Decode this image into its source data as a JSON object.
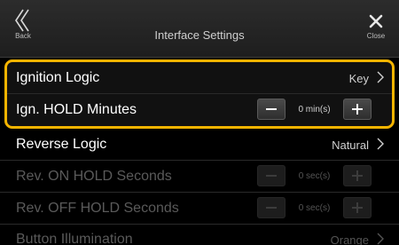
{
  "header": {
    "title": "Interface Settings",
    "back_label": "Back",
    "close_label": "Close"
  },
  "rows": [
    {
      "label": "Ignition Logic",
      "value": "Key"
    },
    {
      "label": "Ign. HOLD Minutes",
      "value": "0 min(s)"
    },
    {
      "label": "Reverse Logic",
      "value": "Natural"
    },
    {
      "label": "Rev. ON HOLD Seconds",
      "value": "0 sec(s)"
    },
    {
      "label": "Rev. OFF HOLD Seconds",
      "value": "0 sec(s)"
    },
    {
      "label": "Button Illumination",
      "value": "Orange"
    }
  ],
  "colors": {
    "highlight": "#f4b400",
    "text": "#ffffff",
    "disabled_text": "#5a5a5a"
  }
}
